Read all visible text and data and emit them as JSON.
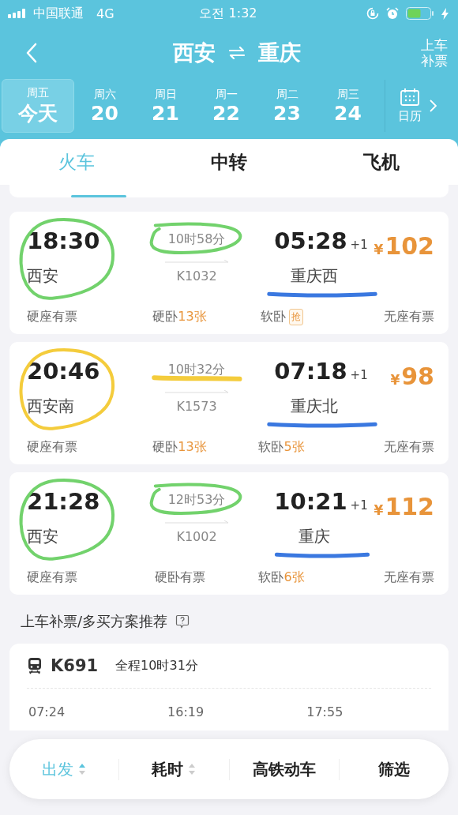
{
  "status_bar": {
    "carrier": "中国联通",
    "network": "4G",
    "time": "오전 1:32"
  },
  "header": {
    "from": "西安",
    "to": "重庆",
    "right_action": "上车补票"
  },
  "dates": [
    {
      "week": "周五",
      "day": "今天",
      "selected": true
    },
    {
      "week": "周六",
      "day": "20",
      "selected": false
    },
    {
      "week": "周日",
      "day": "21",
      "selected": false
    },
    {
      "week": "周一",
      "day": "22",
      "selected": false
    },
    {
      "week": "周二",
      "day": "23",
      "selected": false
    },
    {
      "week": "周三",
      "day": "24",
      "selected": false
    }
  ],
  "calendar_label": "日历",
  "tabs": [
    {
      "label": "火车",
      "selected": true
    },
    {
      "label": "中转",
      "selected": false
    },
    {
      "label": "飞机",
      "selected": false
    }
  ],
  "trains": [
    {
      "depart_time": "18:30",
      "depart_station": "西安",
      "duration": "10时58分",
      "train_no": "K1032",
      "arrive_time": "05:28",
      "day_offset": "+1",
      "arrive_station": "重庆西",
      "price_symbol": "¥",
      "price": "102",
      "seats": [
        {
          "kind": "plain",
          "name": "硬座",
          "avail": "有票"
        },
        {
          "kind": "count",
          "name": "硬卧",
          "avail": "13张"
        },
        {
          "kind": "badge",
          "name": "软卧",
          "avail": "抢"
        },
        {
          "kind": "plain",
          "name": "无座",
          "avail": "有票"
        }
      ],
      "depart_mark": {
        "kind": "circle",
        "color": "#72d26c"
      },
      "duration_mark": {
        "kind": "circle",
        "color": "#72d26c"
      },
      "arrive_mark": {
        "kind": "underline",
        "color": "#3a78e0"
      }
    },
    {
      "depart_time": "20:46",
      "depart_station": "西安南",
      "duration": "10时32分",
      "train_no": "K1573",
      "arrive_time": "07:18",
      "day_offset": "+1",
      "arrive_station": "重庆北",
      "price_symbol": "¥",
      "price": "98",
      "seats": [
        {
          "kind": "plain",
          "name": "硬座",
          "avail": "有票"
        },
        {
          "kind": "count",
          "name": "硬卧",
          "avail": "13张"
        },
        {
          "kind": "count",
          "name": "软卧",
          "avail": "5张"
        },
        {
          "kind": "plain",
          "name": "无座",
          "avail": "有票"
        }
      ],
      "depart_mark": {
        "kind": "circle",
        "color": "#f4cc3c"
      },
      "duration_mark": {
        "kind": "underline",
        "color": "#f4cc3c"
      },
      "arrive_mark": {
        "kind": "underline",
        "color": "#3a78e0"
      }
    },
    {
      "depart_time": "21:28",
      "depart_station": "西安",
      "duration": "12时53分",
      "train_no": "K1002",
      "arrive_time": "10:21",
      "day_offset": "+1",
      "arrive_station": "重庆",
      "price_symbol": "¥",
      "price": "112",
      "seats": [
        {
          "kind": "plain",
          "name": "硬座",
          "avail": "有票"
        },
        {
          "kind": "plain",
          "name": "硬卧",
          "avail": "有票"
        },
        {
          "kind": "count",
          "name": "软卧",
          "avail": "6张"
        },
        {
          "kind": "plain",
          "name": "无座",
          "avail": "有票"
        }
      ],
      "depart_mark": {
        "kind": "circle",
        "color": "#72d26c"
      },
      "duration_mark": {
        "kind": "circle",
        "color": "#72d26c"
      },
      "arrive_mark": {
        "kind": "underline",
        "color": "#3a78e0"
      }
    }
  ],
  "recommend": {
    "title": "上车补票/多买方案推荐",
    "train_no": "K691",
    "total": "全程10时31分",
    "times": [
      "07:24",
      "16:19",
      "17:55"
    ]
  },
  "sort_bar": [
    {
      "label": "出发",
      "sortable": true,
      "selected": true
    },
    {
      "label": "耗时",
      "sortable": true,
      "selected": false
    },
    {
      "label": "高铁动车",
      "sortable": false,
      "selected": false
    },
    {
      "label": "筛选",
      "sortable": false,
      "selected": false
    }
  ]
}
